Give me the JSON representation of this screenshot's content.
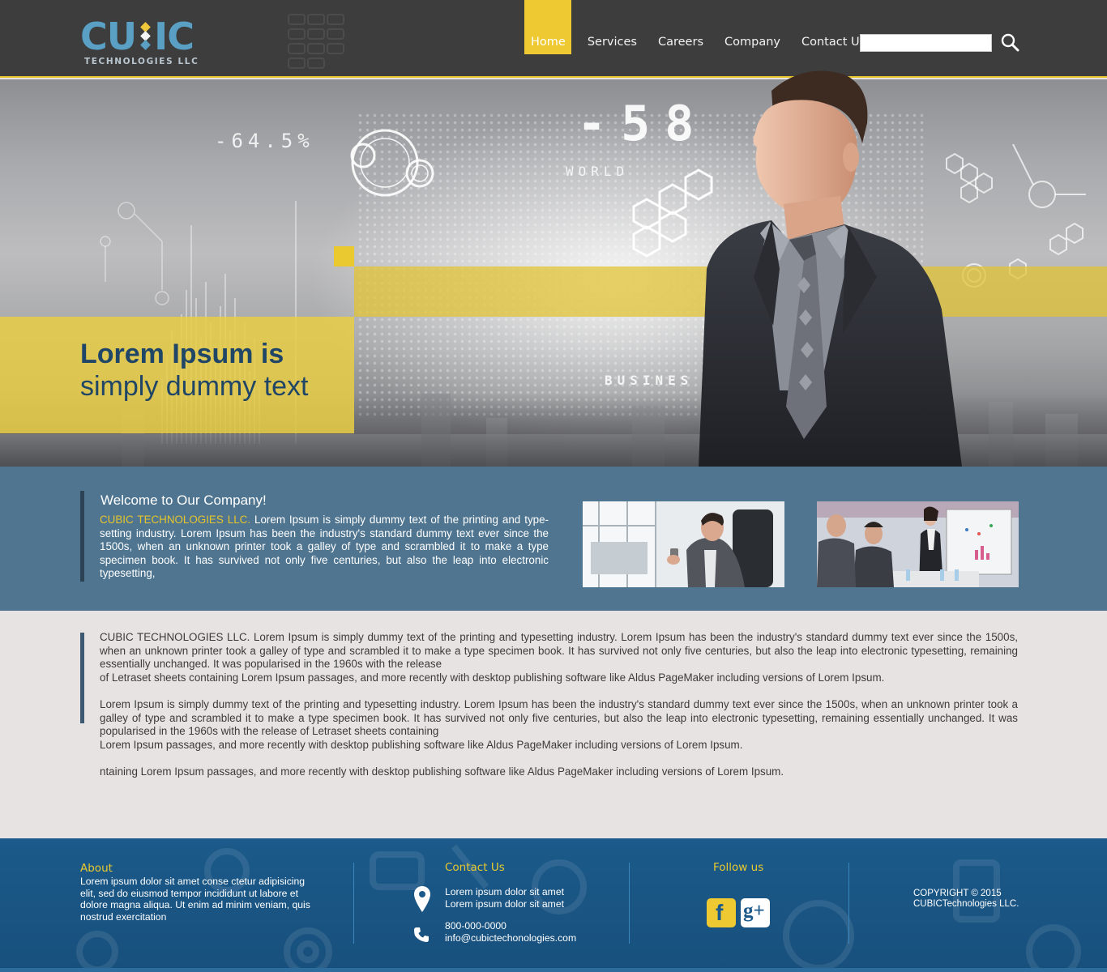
{
  "logo": {
    "text_left": "CU",
    "text_right": "IC",
    "subtitle": "TECHNOLOGIES LLC"
  },
  "nav": {
    "items": [
      {
        "label": "Home",
        "active": true
      },
      {
        "label": "Services"
      },
      {
        "label": "Careers"
      },
      {
        "label": "Company"
      },
      {
        "label": "Contact Us"
      }
    ]
  },
  "search": {
    "value": "",
    "icon": "search-icon"
  },
  "hero": {
    "title": "Lorem Ipsum is",
    "subtitle": "simply dummy text",
    "hud_percent": "-64.5%",
    "hud_number": "-58",
    "hud_world": "WORLD",
    "hud_business": "BUSINES"
  },
  "welcome": {
    "title": "Welcome to Our Company!",
    "highlight": "CUBIC TECHNOLOGIES LLC.",
    "text": " Lorem Ipsum is simply dummy text of the printing and type-setting industry. Lorem Ipsum has been the industry's standard dummy text ever since the 1500s, when an unknown printer took a galley of type and scrambled it to make a type specimen book. It has survived not only five centuries, but also the leap into electronic typesetting,"
  },
  "main": {
    "paragraphs": [
      "CUBIC TECHNOLOGIES LLC. Lorem Ipsum is simply dummy text of the printing and typesetting industry. Lorem Ipsum has been the industry's standard dummy text ever since the 1500s, when an unknown printer took a galley of type and scrambled it to make a type specimen book. It has survived not only five centuries, but also the leap into electronic typesetting, remaining essentially unchanged. It was popularised in the 1960s with the release",
      "of Letraset sheets containing Lorem Ipsum passages, and more recently with desktop publishing software like Aldus PageMaker including versions of Lorem Ipsum.",
      "Lorem Ipsum is simply dummy text of the printing and typesetting industry. Lorem Ipsum has been the industry's standard dummy text ever since the 1500s, when an unknown printer took a galley of type and scrambled it to make a type specimen book. It has survived not only five centuries, but also the leap into electronic typesetting, remaining essentially unchanged. It was popularised in the 1960s with the release of Letraset sheets containing",
      "Lorem Ipsum passages, and more recently with desktop publishing software like Aldus PageMaker including versions of Lorem Ipsum.",
      "ntaining Lorem Ipsum passages, and more recently with desktop publishing software like Aldus PageMaker including versions of Lorem Ipsum."
    ]
  },
  "footer": {
    "about_title": "About",
    "about_text": "Lorem ipsum dolor sit amet conse ctetur adipisicing elit, sed do eiusmod tempor incididunt ut labore et dolore magna aliqua. Ut enim ad minim veniam, quis nostrud exercitation",
    "contact_title": "Contact Us",
    "address_line1": "Lorem ipsum dolor sit amet",
    "address_line2": "Lorem ipsum dolor sit amet",
    "phone": "800-000-0000",
    "email": "info@cubictechonologies.com",
    "follow_title": "Follow us",
    "facebook_label": "f",
    "gplus_label": "g+",
    "copyright_line1": "COPYRIGHT © 2015",
    "copyright_line2": "CUBICTechnologies LLC."
  },
  "colors": {
    "header_bg": "#3d3d3e",
    "accent_yellow": "#efc931",
    "welcome_bg": "#4f7590",
    "body_bg": "#e8e3e3",
    "footer_bg": "#1b5a8a",
    "heading_blue": "#1f4567"
  }
}
